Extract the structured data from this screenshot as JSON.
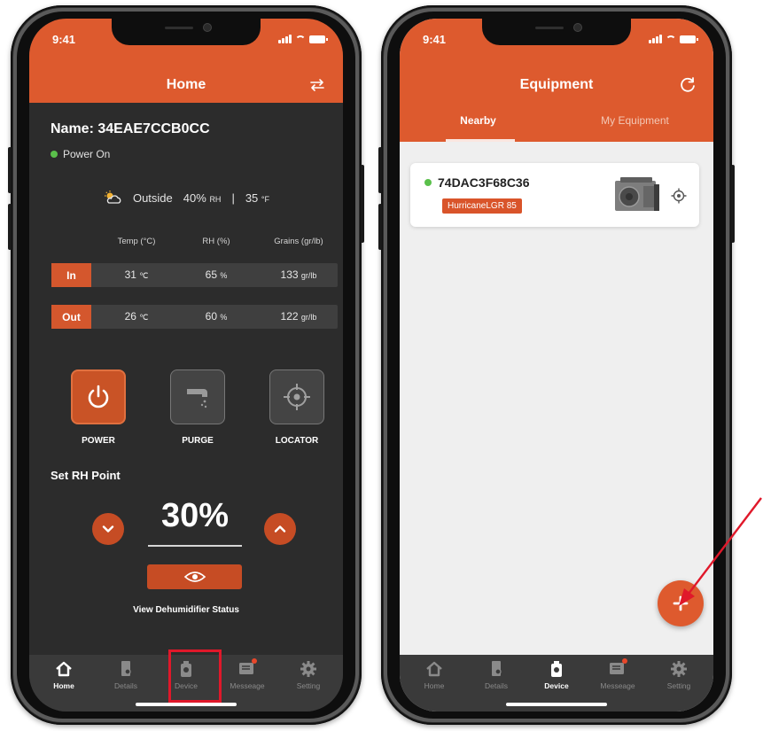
{
  "status_bar": {
    "time": "9:41"
  },
  "home_screen": {
    "title": "Home",
    "device_name": "Name: 34EAE7CCB0CC",
    "power_status": "Power On",
    "outside": {
      "label": "Outside",
      "rh": "40%",
      "rh_unit": "RH",
      "separator": "|",
      "temp": "35",
      "temp_unit": "°F"
    },
    "columns": [
      "Temp (°C)",
      "RH (%)",
      "Grains (gr/lb)"
    ],
    "rows": [
      {
        "label": "In",
        "temp": "31",
        "temp_unit": "℃",
        "rh": "65",
        "rh_unit": "%",
        "grains": "133",
        "grains_unit": "gr/lb"
      },
      {
        "label": "Out",
        "temp": "26",
        "temp_unit": "℃",
        "rh": "60",
        "rh_unit": "%",
        "grains": "122",
        "grains_unit": "gr/lb"
      }
    ],
    "controls": {
      "power": "POWER",
      "purge": "PURGE",
      "locator": "LOCATOR"
    },
    "set_rh_title": "Set RH Point",
    "setpoint": "30%",
    "view_status_label": "View Dehumidifier Status"
  },
  "equipment_screen": {
    "title": "Equipment",
    "tabs": {
      "nearby": "Nearby",
      "my_equipment": "My Equipment"
    },
    "device": {
      "id": "74DAC3F68C36",
      "model": "HurricaneLGR 85"
    }
  },
  "tabbar": {
    "items": [
      {
        "label": "Home",
        "icon": "home-icon"
      },
      {
        "label": "Details",
        "icon": "details-icon"
      },
      {
        "label": "Device",
        "icon": "device-icon"
      },
      {
        "label": "Messeage",
        "icon": "message-icon"
      },
      {
        "label": "Setting",
        "icon": "gear-icon"
      }
    ]
  },
  "colors": {
    "accent": "#dd5a2e",
    "dark_bg": "#2c2c2c",
    "highlight": "#e0182a",
    "online": "#5ac04b"
  }
}
